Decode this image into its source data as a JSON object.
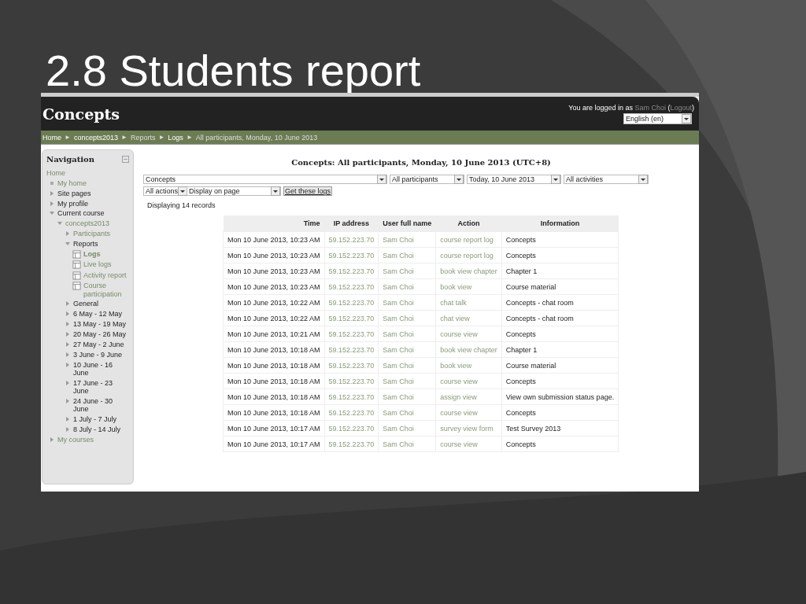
{
  "slide": {
    "title": "2.8 Students report"
  },
  "site": {
    "name": "Concepts",
    "login": {
      "prefix": "You are logged in as",
      "user": "Sam Choi",
      "open": "(",
      "logout": "Logout",
      "close": ")"
    },
    "language": "English (en)"
  },
  "breadcrumb": {
    "separator": "►",
    "items": [
      {
        "label": "Home",
        "link": true
      },
      {
        "label": "concepts2013",
        "link": true
      },
      {
        "label": "Reports",
        "link": false
      },
      {
        "label": "Logs",
        "link": true
      },
      {
        "label": "All participants, Monday, 10 June 2013",
        "link": false
      }
    ]
  },
  "navigation": {
    "title": "Navigation",
    "items": [
      {
        "label": "Home",
        "kind": "home",
        "link": true,
        "selected": false,
        "children": [
          {
            "label": "My home",
            "kind": "leaf",
            "link": true,
            "selected": false
          },
          {
            "label": "Site pages",
            "kind": "collapsed",
            "link": false,
            "selected": false
          },
          {
            "label": "My profile",
            "kind": "collapsed",
            "link": false,
            "selected": false
          },
          {
            "label": "Current course",
            "kind": "expanded",
            "link": false,
            "selected": false,
            "children": [
              {
                "label": "concepts2013",
                "kind": "expanded",
                "link": true,
                "selected": false,
                "children": [
                  {
                    "label": "Participants",
                    "kind": "collapsed",
                    "link": true,
                    "selected": false
                  },
                  {
                    "label": "Reports",
                    "kind": "expanded",
                    "link": false,
                    "selected": false,
                    "children": [
                      {
                        "label": "Logs",
                        "kind": "page",
                        "link": true,
                        "selected": true
                      },
                      {
                        "label": "Live logs",
                        "kind": "page",
                        "link": true,
                        "selected": false
                      },
                      {
                        "label": "Activity report",
                        "kind": "page",
                        "link": true,
                        "selected": false
                      },
                      {
                        "label": "Course participation",
                        "kind": "page",
                        "link": true,
                        "selected": false
                      }
                    ]
                  },
                  {
                    "label": "General",
                    "kind": "collapsed",
                    "link": false,
                    "selected": false
                  },
                  {
                    "label": "6 May - 12 May",
                    "kind": "collapsed",
                    "link": false,
                    "selected": false
                  },
                  {
                    "label": "13 May - 19 May",
                    "kind": "collapsed",
                    "link": false,
                    "selected": false
                  },
                  {
                    "label": "20 May - 26 May",
                    "kind": "collapsed",
                    "link": false,
                    "selected": false
                  },
                  {
                    "label": "27 May - 2 June",
                    "kind": "collapsed",
                    "link": false,
                    "selected": false
                  },
                  {
                    "label": "3 June - 9 June",
                    "kind": "collapsed",
                    "link": false,
                    "selected": false
                  },
                  {
                    "label": "10 June - 16 June",
                    "kind": "collapsed",
                    "link": false,
                    "selected": false
                  },
                  {
                    "label": "17 June - 23 June",
                    "kind": "collapsed",
                    "link": false,
                    "selected": false
                  },
                  {
                    "label": "24 June - 30 June",
                    "kind": "collapsed",
                    "link": false,
                    "selected": false
                  },
                  {
                    "label": "1 July - 7 July",
                    "kind": "collapsed",
                    "link": false,
                    "selected": false
                  },
                  {
                    "label": "8 July - 14 July",
                    "kind": "collapsed",
                    "link": false,
                    "selected": false
                  }
                ]
              }
            ]
          },
          {
            "label": "My courses",
            "kind": "collapsed",
            "link": true,
            "selected": false
          }
        ]
      }
    ]
  },
  "report": {
    "heading": "Concepts: All participants, Monday, 10 June 2013 (UTC+8)",
    "filters": [
      [
        "Concepts",
        "All participants",
        "Today, 10 June 2013",
        "All activities"
      ],
      [
        "All actions",
        "Display on page"
      ]
    ],
    "submit": "Get these logs",
    "count": "Displaying 14 records",
    "table": {
      "columns": [
        {
          "label": "Time",
          "link": false
        },
        {
          "label": "IP address",
          "link": true
        },
        {
          "label": "User full name",
          "link": true
        },
        {
          "label": "Action",
          "link": true
        },
        {
          "label": "Information",
          "link": false
        }
      ],
      "rows": [
        [
          "Mon 10 June 2013, 10:23 AM",
          "59.152.223.70",
          "Sam Choi",
          "course report log",
          "Concepts"
        ],
        [
          "Mon 10 June 2013, 10:23 AM",
          "59.152.223.70",
          "Sam Choi",
          "course report log",
          "Concepts"
        ],
        [
          "Mon 10 June 2013, 10:23 AM",
          "59.152.223.70",
          "Sam Choi",
          "book view chapter",
          "Chapter 1"
        ],
        [
          "Mon 10 June 2013, 10:23 AM",
          "59.152.223.70",
          "Sam Choi",
          "book view",
          "Course material"
        ],
        [
          "Mon 10 June 2013, 10:22 AM",
          "59.152.223.70",
          "Sam Choi",
          "chat talk",
          "Concepts - chat room"
        ],
        [
          "Mon 10 June 2013, 10:22 AM",
          "59.152.223.70",
          "Sam Choi",
          "chat view",
          "Concepts - chat room"
        ],
        [
          "Mon 10 June 2013, 10:21 AM",
          "59.152.223.70",
          "Sam Choi",
          "course view",
          "Concepts"
        ],
        [
          "Mon 10 June 2013, 10:18 AM",
          "59.152.223.70",
          "Sam Choi",
          "book view chapter",
          "Chapter 1"
        ],
        [
          "Mon 10 June 2013, 10:18 AM",
          "59.152.223.70",
          "Sam Choi",
          "book view",
          "Course material"
        ],
        [
          "Mon 10 June 2013, 10:18 AM",
          "59.152.223.70",
          "Sam Choi",
          "course view",
          "Concepts"
        ],
        [
          "Mon 10 June 2013, 10:18 AM",
          "59.152.223.70",
          "Sam Choi",
          "assign view",
          "View own submission status page."
        ],
        [
          "Mon 10 June 2013, 10:18 AM",
          "59.152.223.70",
          "Sam Choi",
          "course view",
          "Concepts"
        ],
        [
          "Mon 10 June 2013, 10:17 AM",
          "59.152.223.70",
          "Sam Choi",
          "survey view form",
          "Test Survey 2013"
        ],
        [
          "Mon 10 June 2013, 10:17 AM",
          "59.152.223.70",
          "Sam Choi",
          "course view",
          "Concepts"
        ]
      ]
    }
  }
}
